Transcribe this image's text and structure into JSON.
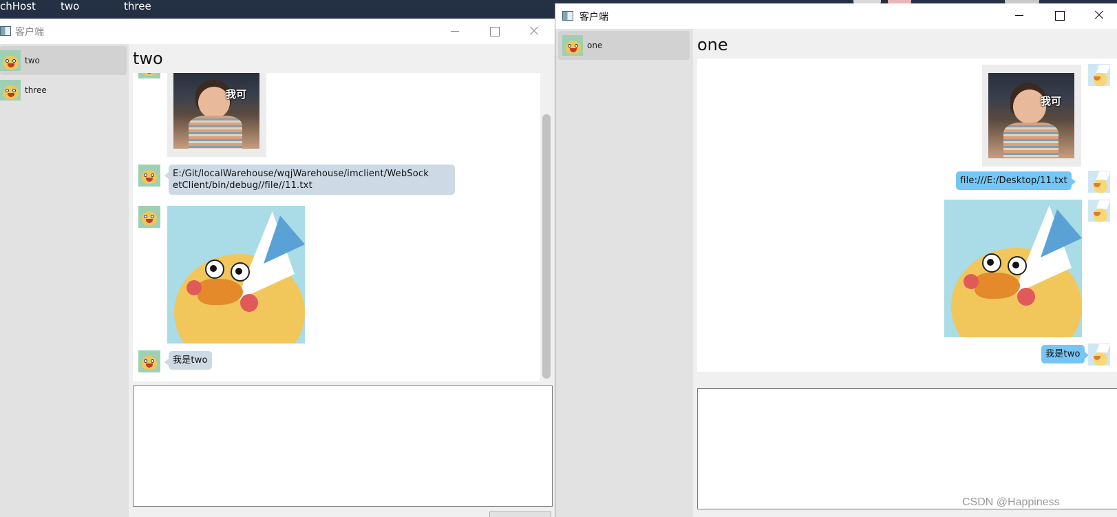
{
  "desktop": {
    "tabs": [
      {
        "label": "chHost"
      },
      {
        "label": "two"
      },
      {
        "label": "three"
      }
    ]
  },
  "left_window": {
    "title": "客户端",
    "contacts": [
      {
        "name": "two",
        "active": true
      },
      {
        "name": "three",
        "active": false
      }
    ],
    "chat_title": "two",
    "messages": [
      {
        "type": "image",
        "image": "toddler-photo",
        "caption": "我可",
        "direction": "received"
      },
      {
        "type": "text",
        "text": "E:/Git/localWarehouse/wqjWarehouse/imclient/WebSocketClient/bin/debug//file//11.txt",
        "line1": "E:/Git/localWarehouse/wqjWarehouse/imclient/WebSock",
        "line2": "etClient/bin/debug//file//11.txt",
        "direction": "received"
      },
      {
        "type": "image",
        "image": "duck-photo",
        "direction": "received"
      },
      {
        "type": "text",
        "text": "我是two",
        "direction": "received"
      }
    ],
    "input_value": ""
  },
  "right_window": {
    "title": "客户端",
    "contacts": [
      {
        "name": "one",
        "active": true
      }
    ],
    "chat_title": "one",
    "messages": [
      {
        "type": "image",
        "image": "toddler-photo",
        "caption": "我可",
        "direction": "sent"
      },
      {
        "type": "text",
        "text": "file:///E:/Desktop/11.txt",
        "direction": "sent"
      },
      {
        "type": "image",
        "image": "duck-photo",
        "direction": "sent"
      },
      {
        "type": "text",
        "text": "我是two",
        "direction": "sent"
      }
    ],
    "input_value": ""
  },
  "watermark": "CSDN @Happiness",
  "colors": {
    "sent_bubble": "#75c6f4",
    "received_bubble": "#cdd9e4",
    "sidebar": "#e2e2e2",
    "active_contact": "#d2d2d2"
  }
}
